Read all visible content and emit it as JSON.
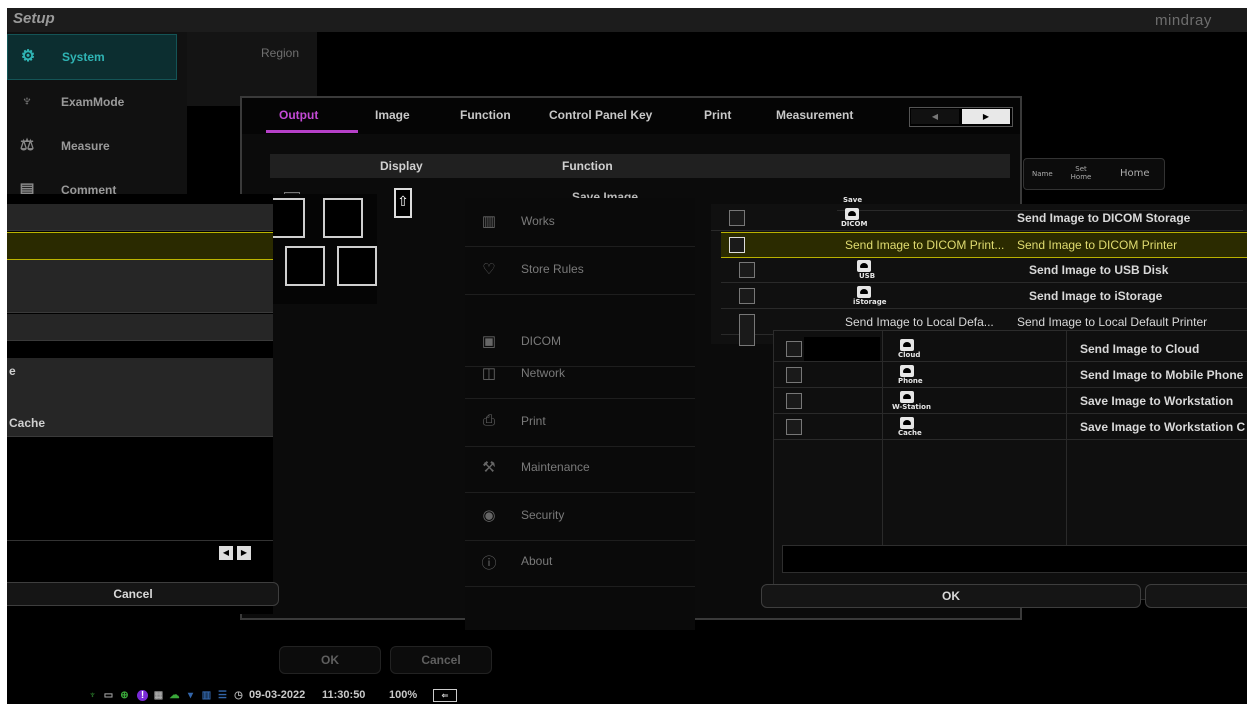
{
  "topbar": {
    "title": "Setup",
    "brand": "mindray"
  },
  "nav": {
    "items": [
      {
        "label": "System",
        "icon": "gear-icon"
      },
      {
        "label": "ExamMode",
        "icon": "probe-icon"
      },
      {
        "label": "Measure",
        "icon": "measure-icon"
      },
      {
        "label": "Comment",
        "icon": "comment-icon"
      }
    ],
    "region_label": "Region"
  },
  "tabs": [
    "Output",
    "Image",
    "Function",
    "Control Panel Key",
    "Print",
    "Measurement"
  ],
  "table": {
    "col_display": "Display",
    "col_function": "Function",
    "first_function": "Save Image"
  },
  "left_panel": {
    "rows": [
      "",
      "",
      "",
      "",
      "",
      "e",
      "",
      "Cache"
    ],
    "cancel_label": "Cancel"
  },
  "middle_list": [
    {
      "label": "Works",
      "icon": "worksheet-icon"
    },
    {
      "label": "Store Rules",
      "icon": "heart-icon"
    },
    {
      "label": "DICOM",
      "icon": "dicom-icon"
    },
    {
      "label": "Network",
      "icon": "network-icon"
    },
    {
      "label": "Print",
      "icon": "printer-icon"
    },
    {
      "label": "Maintenance",
      "icon": "wrench-icon"
    },
    {
      "label": "Security",
      "icon": "lock-icon"
    },
    {
      "label": "About",
      "icon": "info-icon"
    }
  ],
  "right_panel_top": [
    {
      "icon_label": "Save",
      "text": ""
    },
    {
      "icon_label": "DICOM",
      "text": "Send Image to DICOM Storage"
    },
    {
      "icon_label": "",
      "text": "Send Image to DICOM Print...",
      "text2": "Send Image to DICOM Printer"
    },
    {
      "icon_label": "USB",
      "text": "Send Image to USB Disk"
    },
    {
      "icon_label": "iStorage",
      "text": "Send Image to iStorage"
    },
    {
      "icon_label": "",
      "text": "Send Image to Local Defa...",
      "text2": "Send Image to Local Default Printer"
    }
  ],
  "right_panel_bottom": [
    {
      "icon_label": "Cloud",
      "text": "Send Image to Cloud"
    },
    {
      "icon_label": "Phone",
      "text": "Send Image to Mobile Phone"
    },
    {
      "icon_label": "W-Station",
      "text": "Save Image to Workstation"
    },
    {
      "icon_label": "Cache",
      "text": "Save Image to Workstation C"
    }
  ],
  "buttons": {
    "ok": "OK",
    "cancel": "Cancel"
  },
  "home_widget": {
    "name": "Name",
    "set_home": "Set Home",
    "home": "Home"
  },
  "status": {
    "date": "09-03-2022",
    "time": "11:30:50",
    "battery": "100%"
  },
  "colors": {
    "accent_tab": "#b640c8",
    "nav_active": "#2fb4b4",
    "highlight": "#b9b100"
  }
}
